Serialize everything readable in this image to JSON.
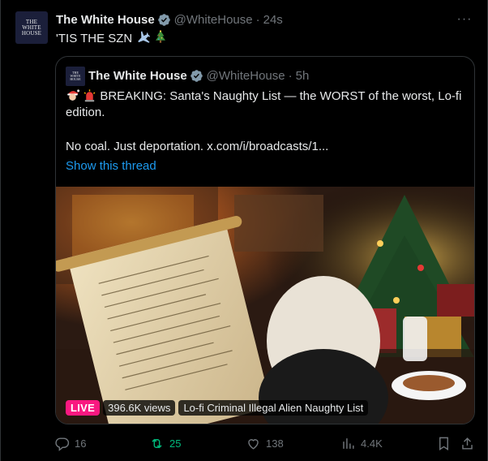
{
  "post": {
    "author_name": "The White House",
    "handle": "@WhiteHouse",
    "separator": "·",
    "time": "24s",
    "text": "'TIS THE SZN",
    "text_emojis": [
      "airplane-emoji",
      "christmas-tree-emoji"
    ],
    "avatar_text": [
      "THE",
      "WHITE",
      "HOUSE"
    ],
    "more_label": "···"
  },
  "quote": {
    "author_name": "The White House",
    "handle": "@WhiteHouse",
    "separator": "·",
    "time": "5h",
    "text": "BREAKING: Santa's Naughty List — the WORST of the worst, Lo-fi edition.",
    "text_emojis": [
      "santa-emoji",
      "siren-emoji"
    ],
    "text2": "No coal. Just deportation.  x.com/i/broadcasts/1...",
    "show_thread": "Show this thread",
    "media": {
      "live_label": "LIVE",
      "views": "396.6K views",
      "title": "Lo-fi Criminal Illegal Alien Naughty List"
    }
  },
  "actions": {
    "replies": "16",
    "reposts": "25",
    "likes": "138",
    "views": "4.4K"
  },
  "colors": {
    "background": "#000000",
    "text": "#e7e9ea",
    "muted": "#71767b",
    "border": "#2f3336",
    "link": "#1d9bf0",
    "verified": "#829aab",
    "live": "#f91880",
    "repost_active": "#00ba7c"
  }
}
